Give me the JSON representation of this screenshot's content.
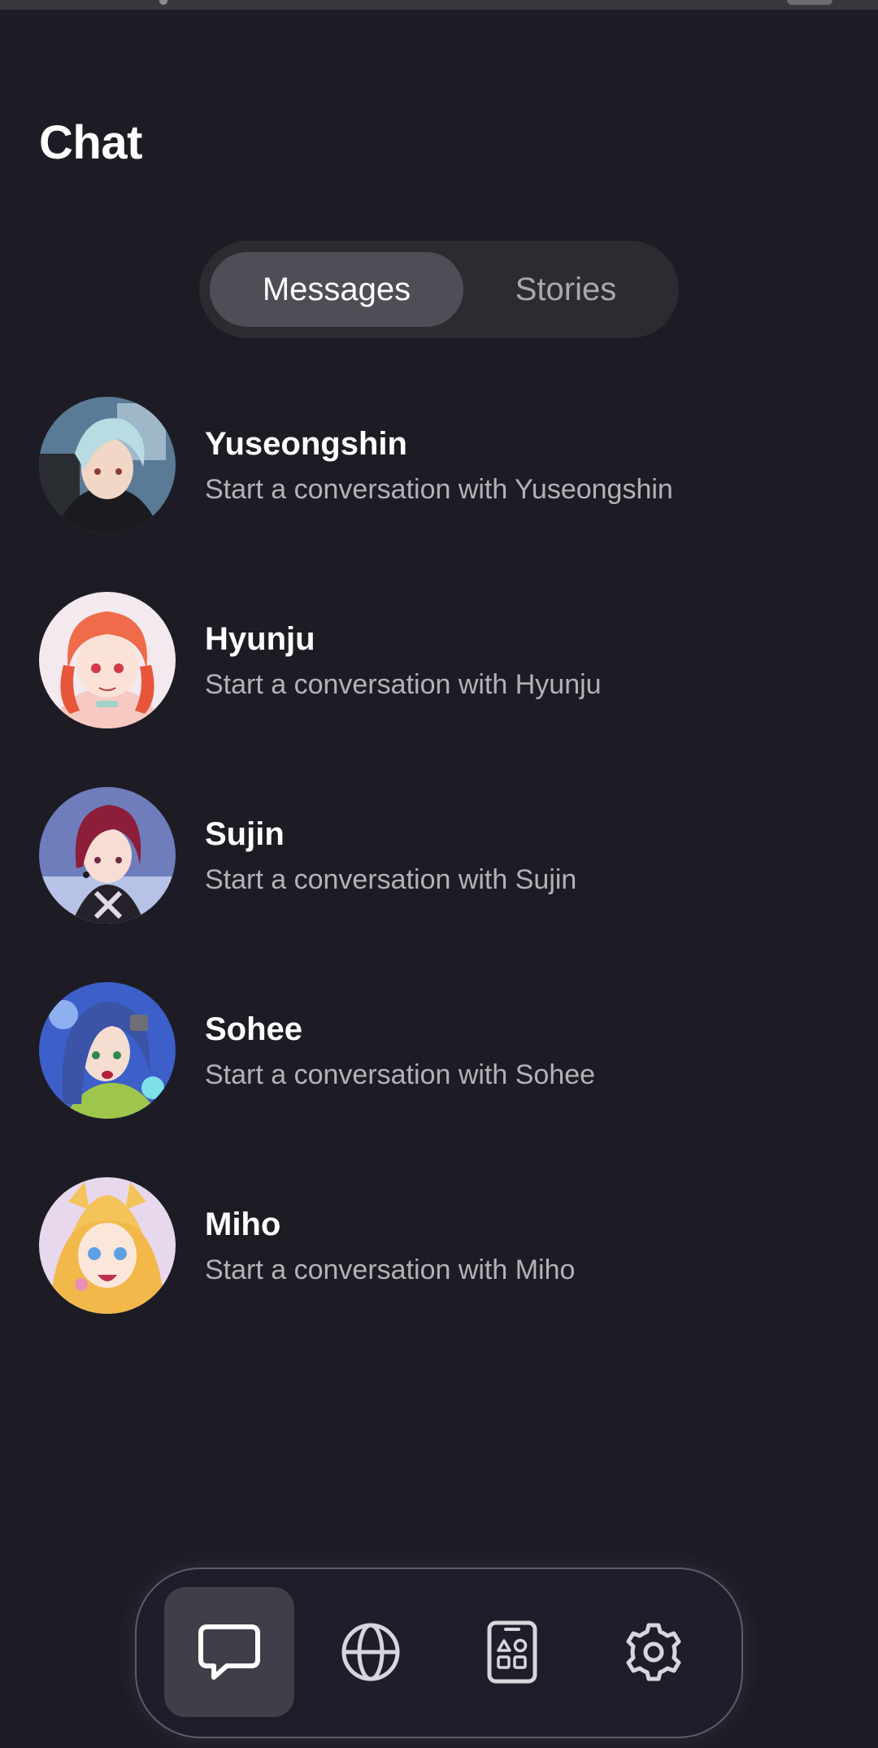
{
  "header": {
    "title": "Chat"
  },
  "tabs": [
    {
      "label": "Messages",
      "selected": true
    },
    {
      "label": "Stories",
      "selected": false
    }
  ],
  "chats": [
    {
      "name": "Yuseongshin",
      "preview": "Start a conversation with Yuseongshin",
      "avatar_icon": "avatar-yuseongshin"
    },
    {
      "name": "Hyunju",
      "preview": "Start a conversation with Hyunju",
      "avatar_icon": "avatar-hyunju"
    },
    {
      "name": "Sujin",
      "preview": "Start a conversation with Sujin",
      "avatar_icon": "avatar-sujin"
    },
    {
      "name": "Sohee",
      "preview": "Start a conversation with Sohee",
      "avatar_icon": "avatar-sohee"
    },
    {
      "name": "Miho",
      "preview": "Start a conversation with Miho",
      "avatar_icon": "avatar-miho"
    }
  ],
  "bottom_nav": [
    {
      "icon": "chat-bubble-icon",
      "active": true
    },
    {
      "icon": "globe-icon",
      "active": false
    },
    {
      "icon": "tablet-shapes-icon",
      "active": false
    },
    {
      "icon": "gear-icon",
      "active": false
    }
  ],
  "colors": {
    "background": "#1d1c24",
    "segment_track": "#2c2b31",
    "segment_active": "#4f4e56",
    "text_primary": "#ffffff",
    "text_secondary": "#b3b2b8",
    "nav_background": "#1e1e2a",
    "nav_active": "#3f3f4a"
  }
}
